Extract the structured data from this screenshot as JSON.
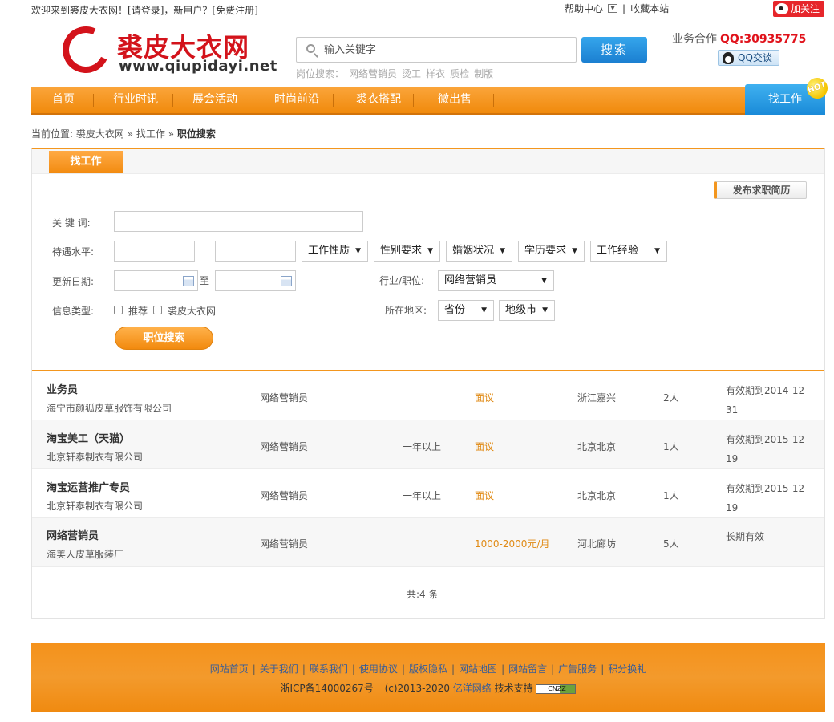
{
  "topbar": {
    "welcome": "欢迎来到裘皮大衣网！",
    "login": "[请登录]",
    "new_user": "，新用户？",
    "register": "[免费注册]",
    "help": "帮助中心",
    "sep": "|",
    "bookmark": "收藏本站",
    "follow": "加关注"
  },
  "header": {
    "logo_cn": "裘皮大衣网",
    "logo_url": "www.qiupidayi.net",
    "search_placeholder": "输入关键字",
    "search_button": "搜索",
    "hot_label": "岗位搜索：",
    "hot_items": [
      "网络营销员",
      "烫工",
      "样衣",
      "质检",
      "制版"
    ],
    "biz_label": "业务合作",
    "biz_qq": "QQ:30935775",
    "qq_chat": "QQ交谈"
  },
  "nav": {
    "items": [
      "首页",
      "行业时讯",
      "展会活动",
      "时尚前沿",
      "裘衣搭配",
      "微出售"
    ],
    "find_job": "找工作",
    "hot_badge": "HOT"
  },
  "breadcrumb": {
    "prefix": "当前位置:",
    "home": "裘皮大衣网",
    "sep": "»",
    "level2": "找工作",
    "current": "职位搜索"
  },
  "panel": {
    "tab": "找工作",
    "post_resume": "发布求职简历",
    "form": {
      "keyword_label": "关 键 词:",
      "keyword_value": "",
      "salary_label": "待遇水平:",
      "salary_sep": "--",
      "job_nature": "工作性质",
      "gender": "性别要求",
      "marital": "婚姻状况",
      "education": "学历要求",
      "experience": "工作经验",
      "date_label": "更新日期:",
      "date_sep": "至",
      "industry_label": "行业/职位:",
      "industry_value": "网络营销员",
      "info_label": "信息类型:",
      "info_opt1": "推荐",
      "info_opt2": "裘皮大衣网",
      "region_label": "所在地区:",
      "province": "省份",
      "city": "地级市",
      "search_button": "职位搜索"
    }
  },
  "jobs": [
    {
      "title": "业务员",
      "company": "海宁市颜狐皮草服饰有限公司",
      "category": "网络营销员",
      "experience": "",
      "salary": "面议",
      "location": "浙江嘉兴",
      "count": "2人",
      "valid": "有效期到2014-12-31"
    },
    {
      "title": "淘宝美工（天猫）",
      "company": "北京轩泰制衣有限公司",
      "category": "网络营销员",
      "experience": "一年以上",
      "salary": "面议",
      "location": "北京北京",
      "count": "1人",
      "valid": "有效期到2015-12-19"
    },
    {
      "title": "淘宝运营推广专员",
      "company": "北京轩泰制衣有限公司",
      "category": "网络营销员",
      "experience": "一年以上",
      "salary": "面议",
      "location": "北京北京",
      "count": "1人",
      "valid": "有效期到2015-12-19"
    },
    {
      "title": "网络营销员",
      "company": "海美人皮草服装厂",
      "category": "网络营销员",
      "experience": "",
      "salary": "1000-2000元/月",
      "location": "河北廊坊",
      "count": "5人",
      "valid": "长期有效"
    }
  ],
  "total": "共:4 条",
  "footer": {
    "links": [
      "网站首页",
      "关于我们",
      "联系我们",
      "使用协议",
      "版权隐私",
      "网站地图",
      "网站留言",
      "广告服务",
      "积分换礼"
    ],
    "icp": "浙ICP备14000267号",
    "copyright": "(c)2013-2020",
    "company": "亿洋网络",
    "support": "技术支持",
    "badge": "CNZZ"
  },
  "colors": {
    "accent": "#f3961e",
    "brand_red": "#d3131b",
    "blue_button": "#1b7fd1"
  }
}
